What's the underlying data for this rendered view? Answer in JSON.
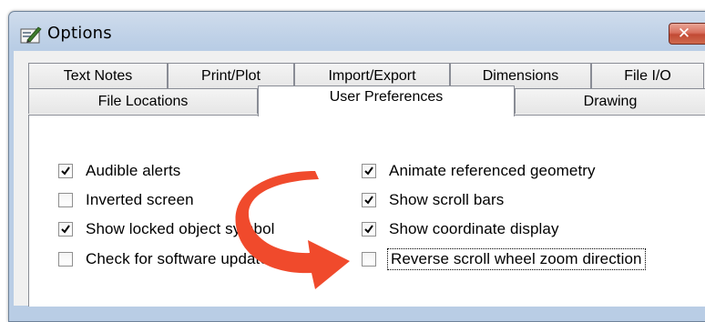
{
  "window": {
    "title": "Options",
    "close_symbol": "✕",
    "icon": "options-app-icon"
  },
  "tabs_row1": [
    {
      "label": "Text Notes"
    },
    {
      "label": "Print/Plot"
    },
    {
      "label": "Import/Export"
    },
    {
      "label": "Dimensions"
    },
    {
      "label": "File I/O"
    }
  ],
  "tabs_row2": [
    {
      "label": "File Locations"
    },
    {
      "label": "User Preferences",
      "active": true
    },
    {
      "label": "Drawing"
    }
  ],
  "options_left": [
    {
      "label": "Audible alerts",
      "checked": true
    },
    {
      "label": "Inverted screen",
      "checked": false
    },
    {
      "label": "Show locked object symbol",
      "checked": true
    },
    {
      "label": "Check for software updates",
      "checked": false
    }
  ],
  "options_right": [
    {
      "label": "Animate referenced geometry",
      "checked": true
    },
    {
      "label": "Show scroll bars",
      "checked": true
    },
    {
      "label": "Show coordinate display",
      "checked": true
    },
    {
      "label": "Reverse scroll wheel zoom direction",
      "checked": false
    }
  ],
  "colors": {
    "arrow": "#f04a2c",
    "titlebar": "#bfd1e7",
    "close_button": "#c9543c"
  }
}
